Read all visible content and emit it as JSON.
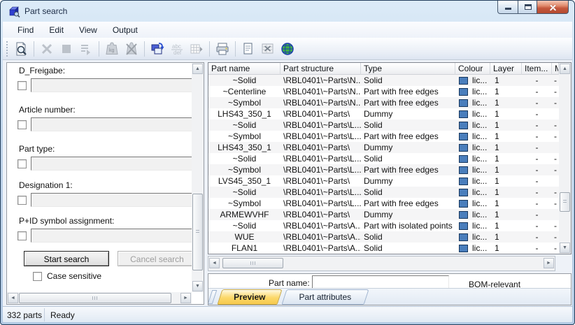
{
  "window": {
    "title": "Part search",
    "controls": [
      {
        "name": "minimize"
      },
      {
        "name": "maximize"
      },
      {
        "name": "close"
      }
    ]
  },
  "menu": {
    "items": [
      "Find",
      "Edit",
      "View",
      "Output"
    ]
  },
  "toolbar": {
    "buttons": [
      {
        "name": "find-parts",
        "enabled": true
      },
      {
        "name": "delete",
        "enabled": false
      },
      {
        "name": "stop",
        "enabled": false
      },
      {
        "name": "append-to-list",
        "enabled": false
      },
      {
        "name": "weight",
        "enabled": false
      },
      {
        "name": "remove-weight",
        "enabled": false
      },
      {
        "name": "copy-parts",
        "enabled": true
      },
      {
        "name": "rename",
        "enabled": false
      },
      {
        "name": "part-table",
        "enabled": false
      },
      {
        "name": "print",
        "enabled": true
      },
      {
        "name": "report",
        "enabled": true
      },
      {
        "name": "excel-export",
        "enabled": false
      },
      {
        "name": "web-export",
        "enabled": true
      }
    ]
  },
  "search_panel": {
    "fields": [
      {
        "name": "d-freigabe",
        "label": "D_Freigabe:",
        "checked": false,
        "value": ""
      },
      {
        "name": "article-number",
        "label": "Article number:",
        "checked": false,
        "value": ""
      },
      {
        "name": "part-type",
        "label": "Part type:",
        "checked": false,
        "value": ""
      },
      {
        "name": "designation-1",
        "label": "Designation 1:",
        "checked": false,
        "value": ""
      },
      {
        "name": "pid-symbol-assignment",
        "label": "P+ID symbol assignment:",
        "checked": false,
        "value": ""
      }
    ],
    "start_button": "Start search",
    "cancel_button": "Cancel search",
    "cancel_enabled": false,
    "case_sensitive_label": "Case sensitive",
    "case_sensitive_checked": false
  },
  "table": {
    "columns": [
      {
        "key": "part-name",
        "label": "Part name"
      },
      {
        "key": "part-structure",
        "label": "Part structure"
      },
      {
        "key": "type",
        "label": "Type"
      },
      {
        "key": "colour",
        "label": "Colour"
      },
      {
        "key": "layer",
        "label": "Layer"
      },
      {
        "key": "item",
        "label": "Item..."
      },
      {
        "key": "m",
        "label": "M..."
      }
    ],
    "rows": [
      {
        "part_name": "~Solid",
        "part_structure": "\\RBL0401\\~Parts\\N...",
        "type": "Solid",
        "colour": "lic...",
        "layer": "1",
        "item": "-",
        "m": "-"
      },
      {
        "part_name": "~Centerline",
        "part_structure": "\\RBL0401\\~Parts\\N...",
        "type": "Part with free edges",
        "colour": "lic...",
        "layer": "1",
        "item": "-",
        "m": "-"
      },
      {
        "part_name": "~Symbol",
        "part_structure": "\\RBL0401\\~Parts\\N...",
        "type": "Part with free edges",
        "colour": "lic...",
        "layer": "1",
        "item": "-",
        "m": "-"
      },
      {
        "part_name": "LHS43_350_1",
        "part_structure": "\\RBL0401\\~Parts\\",
        "type": "Dummy",
        "colour": "lic...",
        "layer": "1",
        "item": "-",
        "m": ""
      },
      {
        "part_name": "~Solid",
        "part_structure": "\\RBL0401\\~Parts\\L...",
        "type": "Solid",
        "colour": "lic...",
        "layer": "1",
        "item": "-",
        "m": "-"
      },
      {
        "part_name": "~Symbol",
        "part_structure": "\\RBL0401\\~Parts\\L...",
        "type": "Part with free edges",
        "colour": "lic...",
        "layer": "1",
        "item": "-",
        "m": "-"
      },
      {
        "part_name": "LHS43_350_1",
        "part_structure": "\\RBL0401\\~Parts\\",
        "type": "Dummy",
        "colour": "lic...",
        "layer": "1",
        "item": "-",
        "m": ""
      },
      {
        "part_name": "~Solid",
        "part_structure": "\\RBL0401\\~Parts\\L...",
        "type": "Solid",
        "colour": "lic...",
        "layer": "1",
        "item": "-",
        "m": "-"
      },
      {
        "part_name": "~Symbol",
        "part_structure": "\\RBL0401\\~Parts\\L...",
        "type": "Part with free edges",
        "colour": "lic...",
        "layer": "1",
        "item": "-",
        "m": "-"
      },
      {
        "part_name": "LVS45_350_1",
        "part_structure": "\\RBL0401\\~Parts\\",
        "type": "Dummy",
        "colour": "lic...",
        "layer": "1",
        "item": "-",
        "m": ""
      },
      {
        "part_name": "~Solid",
        "part_structure": "\\RBL0401\\~Parts\\L...",
        "type": "Solid",
        "colour": "lic...",
        "layer": "1",
        "item": "-",
        "m": "-"
      },
      {
        "part_name": "~Symbol",
        "part_structure": "\\RBL0401\\~Parts\\L...",
        "type": "Part with free edges",
        "colour": "lic...",
        "layer": "1",
        "item": "-",
        "m": "-"
      },
      {
        "part_name": "ARMEWVHF",
        "part_structure": "\\RBL0401\\~Parts\\",
        "type": "Dummy",
        "colour": "lic...",
        "layer": "1",
        "item": "-",
        "m": ""
      },
      {
        "part_name": "~Solid",
        "part_structure": "\\RBL0401\\~Parts\\A...",
        "type": "Part with isolated points",
        "colour": "lic...",
        "layer": "1",
        "item": "-",
        "m": "-"
      },
      {
        "part_name": "WUE",
        "part_structure": "\\RBL0401\\~Parts\\A...",
        "type": "Solid",
        "colour": "lic...",
        "layer": "1",
        "item": "-",
        "m": "-"
      },
      {
        "part_name": "FLAN1",
        "part_structure": "\\RBL0401\\~Parts\\A...",
        "type": "Solid",
        "colour": "lic...",
        "layer": "1",
        "item": "-",
        "m": "-"
      }
    ]
  },
  "bottom_panel": {
    "part_name_label": "Part name:",
    "part_name_value": "",
    "bom_label": "BOM-relevant",
    "tabs": [
      {
        "label": "Preview",
        "active": true
      },
      {
        "label": "Part attributes",
        "active": false
      }
    ]
  },
  "status_bar": {
    "parts_count": "332 parts",
    "status": "Ready"
  },
  "colors": {
    "part_colour_swatch": "#4a7ebc",
    "active_tab_gold": "#fbd44f",
    "close_button_red": "#c4573c",
    "titlebar_blue": "#bfd4ea"
  }
}
